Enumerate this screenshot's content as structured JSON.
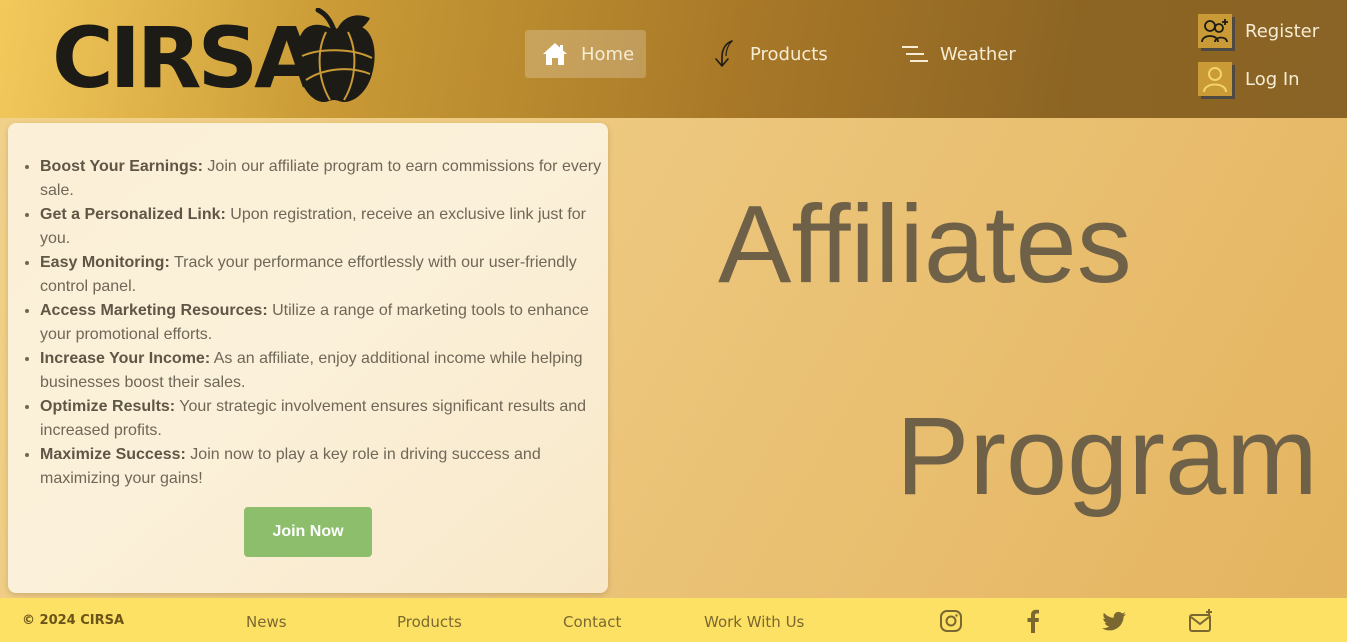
{
  "brand": {
    "name": "CIRSA"
  },
  "nav": {
    "items": [
      {
        "label": "Home",
        "icon": "home-icon"
      },
      {
        "label": "Products",
        "icon": "arrow-icon"
      },
      {
        "label": "Weather",
        "icon": "menu-lines-icon"
      }
    ],
    "active": "Home"
  },
  "auth": {
    "register_label": "Register",
    "login_label": "Log In"
  },
  "benefits": [
    {
      "title": "Boost Your Earnings:",
      "text": " Join our affiliate program to earn commissions for every sale."
    },
    {
      "title": "Get a Personalized Link:",
      "text": " Upon registration, receive an exclusive link just for you."
    },
    {
      "title": "Easy Monitoring:",
      "text": " Track your performance effortlessly with our user-friendly control panel."
    },
    {
      "title": "Access Marketing Resources:",
      "text": " Utilize a range of marketing tools to enhance your promotional efforts."
    },
    {
      "title": "Increase Your Income:",
      "text": " As an affiliate, enjoy additional income while helping businesses boost their sales."
    },
    {
      "title": "Optimize Results:",
      "text": " Your strategic involvement ensures significant results and increased profits."
    },
    {
      "title": "Maximize Success:",
      "text": " Join now to play a key role in driving success and maximizing your gains!"
    }
  ],
  "cta": {
    "join_label": "Join Now"
  },
  "hero": {
    "word1": "Affiliates",
    "word2": "Program"
  },
  "footer": {
    "copyright": "© 2024 CIRSA",
    "links": [
      "News",
      "Products",
      "Contact",
      "Work With Us"
    ],
    "social_icons": [
      "instagram-icon",
      "facebook-icon",
      "twitter-icon",
      "mail-icon"
    ]
  },
  "colors": {
    "header_dark": "#8a6426",
    "accent_gold": "#c99a35",
    "footer_bg": "#fde165",
    "button_green": "#8cbe6c",
    "hero_text": "#6f6148"
  }
}
